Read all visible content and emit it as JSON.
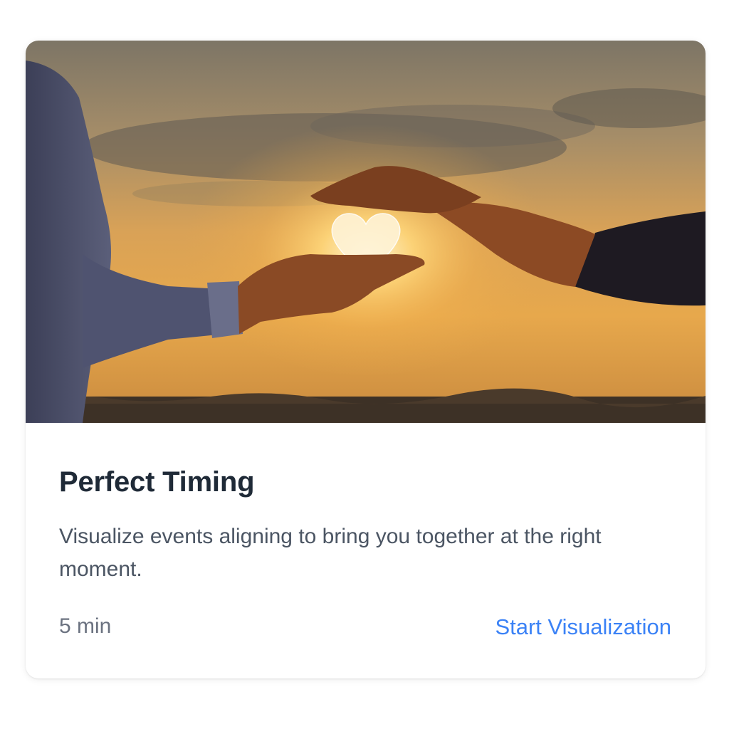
{
  "card": {
    "title": "Perfect Timing",
    "description": "Visualize events aligning to bring you together at the right moment.",
    "duration": "5 min",
    "action_label": "Start Visualization"
  },
  "colors": {
    "title": "#1f2a37",
    "text": "#4b5563",
    "muted": "#6b7280",
    "accent": "#3b82f6",
    "sky_top": "#8a8070",
    "sky_glow": "#f2b544"
  }
}
